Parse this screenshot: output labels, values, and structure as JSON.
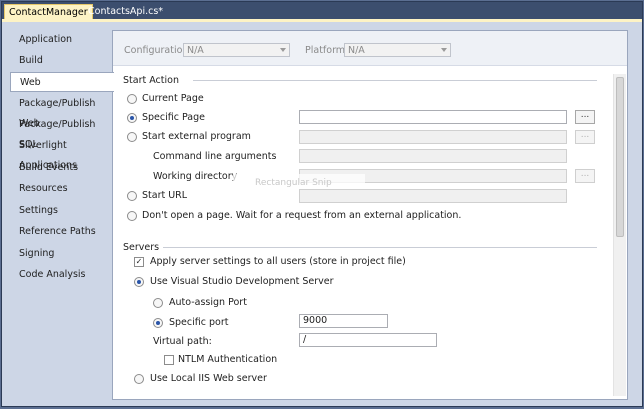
{
  "tabs": {
    "active": "ContactManager",
    "inactive": "ContactsApi.cs*"
  },
  "nav": [
    "Application",
    "Build",
    "Web",
    "Package/Publish Web",
    "Package/Publish SQL",
    "Silverlight Applications",
    "Build Events",
    "Resources",
    "Settings",
    "Reference Paths",
    "Signing",
    "Code Analysis"
  ],
  "nav_selected": "Web",
  "config": {
    "configuration_label": "Configuration:",
    "configuration_value": "N/A",
    "platform_label": "Platform:",
    "platform_value": "N/A"
  },
  "start_action": {
    "title": "Start Action",
    "current_page": "Current Page",
    "specific_page": "Specific Page",
    "external_program": "Start external program",
    "cmd_args": "Command line arguments",
    "working_dir": "Working directory",
    "start_url": "Start URL",
    "dont_open": "Don't open a page.  Wait for a request from an external application.",
    "selected": "specific_page",
    "browse": "..."
  },
  "overlay_hint": "Rectangular Snip",
  "servers": {
    "title": "Servers",
    "apply_all": "Apply server settings to all users (store in project file)",
    "use_vs_dev": "Use Visual Studio Development Server",
    "auto_assign": "Auto-assign Port",
    "specific_port": "Specific port",
    "port_value": "9000",
    "virtual_path_label": "Virtual path:",
    "virtual_path_value": "/",
    "ntlm": "NTLM Authentication",
    "use_local_iis": "Use Local IIS Web server"
  },
  "colors": {
    "accent": "#fdf3c5",
    "background": "#cdd6e6",
    "radio_dot": "#2a55a8"
  }
}
